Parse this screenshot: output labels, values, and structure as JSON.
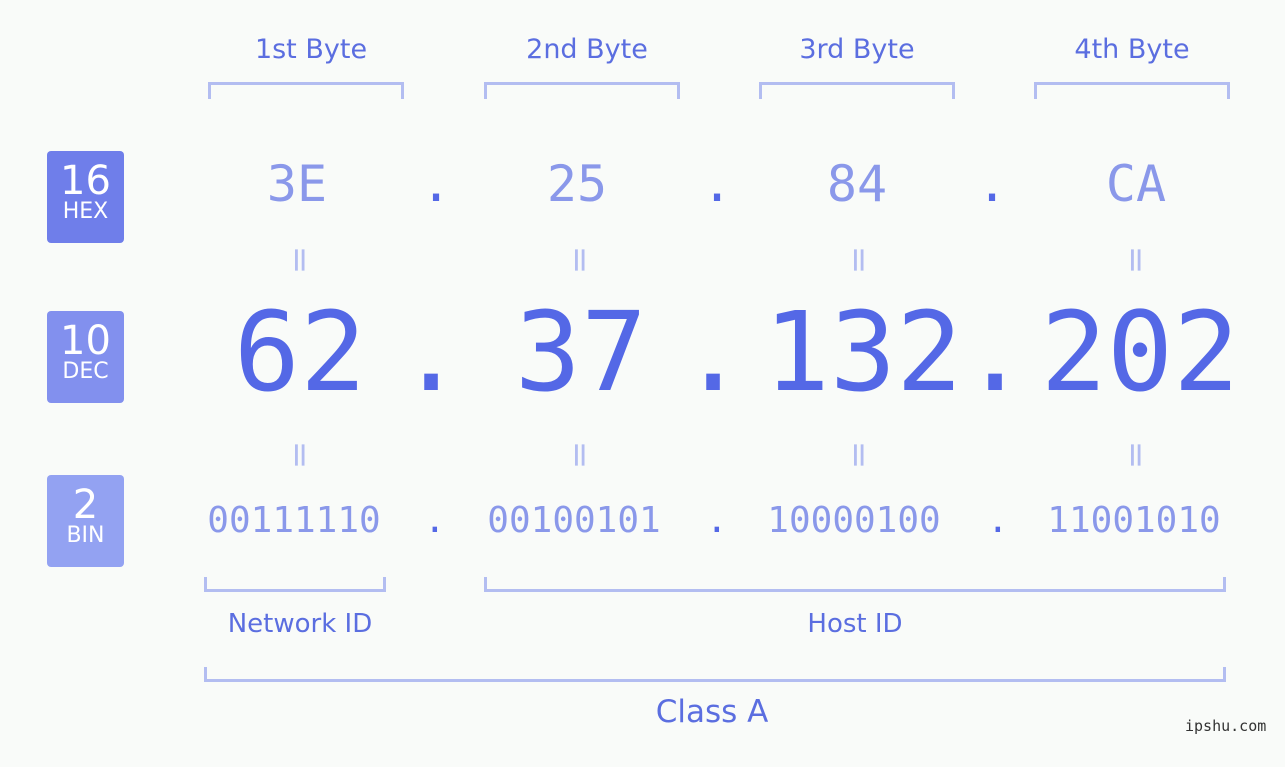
{
  "bytes": [
    {
      "label": "1st Byte",
      "hex": "3E",
      "dec": "62",
      "bin": "00111110"
    },
    {
      "label": "2nd Byte",
      "hex": "25",
      "dec": "37",
      "bin": "00100101"
    },
    {
      "label": "3rd Byte",
      "hex": "84",
      "dec": "132",
      "bin": "10000100"
    },
    {
      "label": "4th Byte",
      "hex": "CA",
      "dec": "202",
      "bin": "11001010"
    }
  ],
  "badges": {
    "hex": {
      "num": "16",
      "label": "HEX",
      "color": "#6f7eea"
    },
    "dec": {
      "num": "10",
      "label": "DEC",
      "color": "#8290ee"
    },
    "bin": {
      "num": "2",
      "label": "BIN",
      "color": "#93a2f2"
    }
  },
  "separator": ".",
  "equals": "=",
  "network_label": "Network ID",
  "host_label": "Host ID",
  "class_label": "Class A",
  "watermark": "ipshu.com"
}
